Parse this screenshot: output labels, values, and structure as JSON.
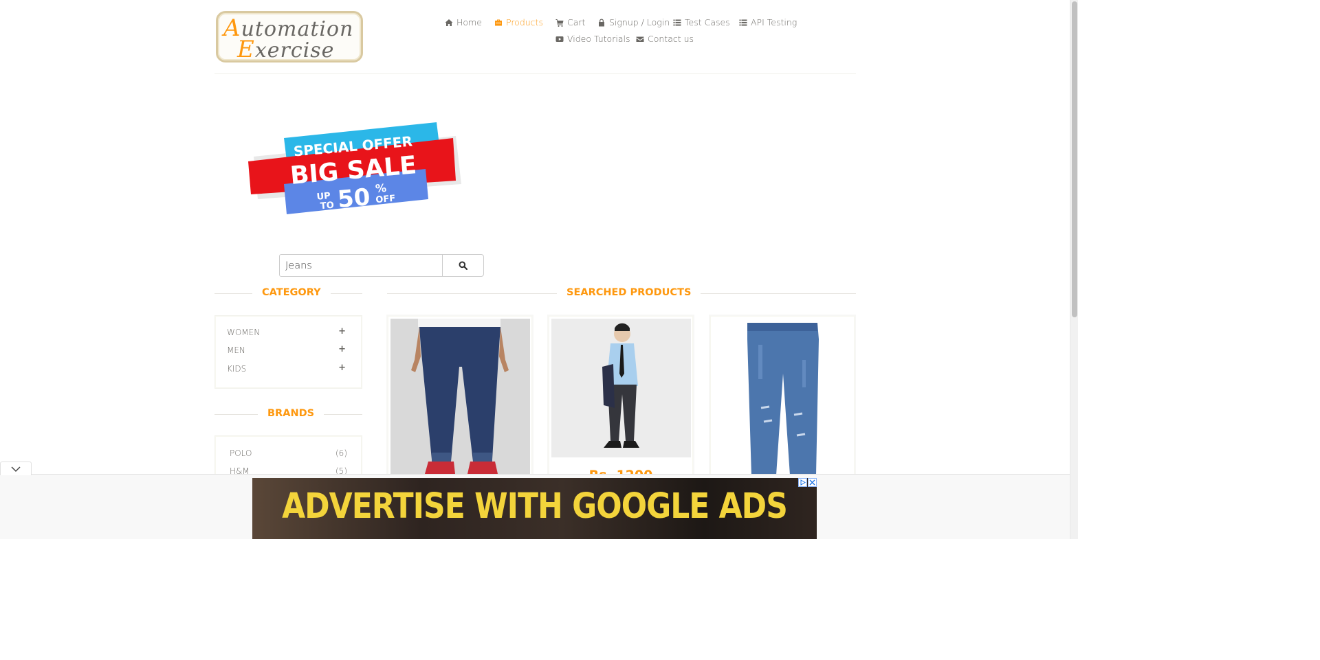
{
  "logo": {
    "line1_cap": "A",
    "line1_rest": "utomation",
    "line2_cap": "E",
    "line2_rest": "xercise"
  },
  "nav": [
    {
      "label": "Home",
      "icon": "home-icon"
    },
    {
      "label": "Products",
      "icon": "briefcase-icon",
      "active": true
    },
    {
      "label": "Cart",
      "icon": "cart-icon"
    },
    {
      "label": "Signup / Login",
      "icon": "lock-icon"
    },
    {
      "label": "Test Cases",
      "icon": "list-icon"
    },
    {
      "label": "API Testing",
      "icon": "list-icon"
    },
    {
      "label": "Video Tutorials",
      "icon": "youtube-icon"
    },
    {
      "label": "Contact us",
      "icon": "envelope-icon"
    }
  ],
  "banner": {
    "line1": "SPECIAL OFFER",
    "line2": "BIG SALE",
    "up": "UP",
    "to": "TO",
    "pct": "50",
    "pct_sign": "%",
    "off": "OFF"
  },
  "search": {
    "value": "Jeans",
    "icon": "search-icon"
  },
  "sidebar": {
    "category_title": "CATEGORY",
    "categories": [
      {
        "label": "WOMEN"
      },
      {
        "label": "MEN"
      },
      {
        "label": "KIDS"
      }
    ],
    "brands_title": "BRANDS",
    "brands": [
      {
        "label": "POLO",
        "count": "(6)"
      },
      {
        "label": "H&M",
        "count": "(5)"
      }
    ]
  },
  "main": {
    "title": "SEARCHED PRODUCTS",
    "products": [
      {
        "price": ""
      },
      {
        "price": "Rs. 1200"
      },
      {
        "price": ""
      }
    ]
  },
  "ad": {
    "text": "ADVERTISE WITH GOOGLE ADS"
  },
  "colors": {
    "accent": "#fe980f",
    "text": "#696763"
  }
}
